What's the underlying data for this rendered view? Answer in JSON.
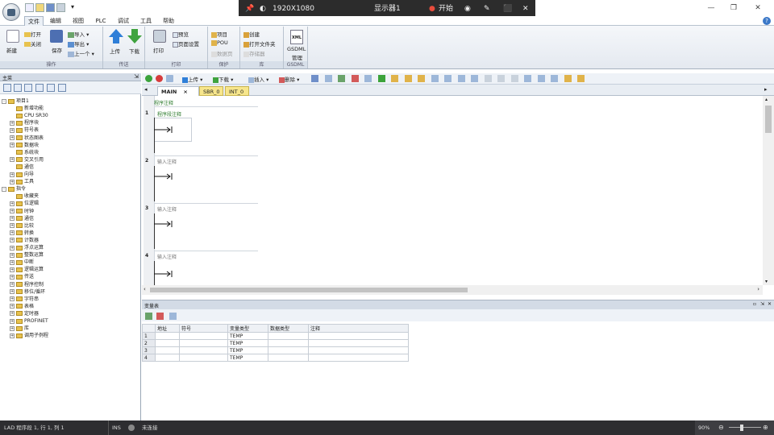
{
  "overlay": {
    "resolution": "1920X1080",
    "display": "显示器1",
    "start": "开始"
  },
  "tabs": [
    "文件",
    "编辑",
    "视图",
    "PLC",
    "调试",
    "工具",
    "帮助"
  ],
  "ribbon": {
    "new": "新建",
    "open": "打开",
    "close": "关闭",
    "save": "保存",
    "import": "导入",
    "export": "导出",
    "prev": "上一个",
    "upload": "上传",
    "download": "下载",
    "print": "打印",
    "preview": "预览",
    "page_setup": "页面设置",
    "project": "项目",
    "pou": "POU",
    "data_page": "数据页",
    "create": "创建",
    "open_folder": "打开文件夹",
    "storage": "存储器",
    "xml": "XML",
    "gsdml": "GSDML",
    "gsdml_manage": "管理",
    "groups": {
      "ops": "操作",
      "transfer": "传送",
      "print": "打印",
      "protect": "保护",
      "lib": "库",
      "gsdml": "GSDML"
    }
  },
  "left_panel": {
    "title": "主菜",
    "tree": [
      {
        "label": "项目1",
        "depth": 0,
        "exp": "-"
      },
      {
        "label": "新增功能",
        "depth": 1,
        "exp": ""
      },
      {
        "label": "CPU SR30",
        "depth": 1,
        "exp": ""
      },
      {
        "label": "程序块",
        "depth": 1,
        "exp": "+"
      },
      {
        "label": "符号表",
        "depth": 1,
        "exp": "+"
      },
      {
        "label": "状态图表",
        "depth": 1,
        "exp": "+"
      },
      {
        "label": "数据块",
        "depth": 1,
        "exp": "+"
      },
      {
        "label": "系统块",
        "depth": 1,
        "exp": ""
      },
      {
        "label": "交叉引用",
        "depth": 1,
        "exp": "+"
      },
      {
        "label": "通信",
        "depth": 1,
        "exp": ""
      },
      {
        "label": "向导",
        "depth": 1,
        "exp": "+"
      },
      {
        "label": "工具",
        "depth": 1,
        "exp": "+"
      },
      {
        "label": "指令",
        "depth": 0,
        "exp": "-"
      },
      {
        "label": "收藏夹",
        "depth": 1,
        "exp": ""
      },
      {
        "label": "位逻辑",
        "depth": 1,
        "exp": "+"
      },
      {
        "label": "时钟",
        "depth": 1,
        "exp": "+"
      },
      {
        "label": "通信",
        "depth": 1,
        "exp": "+"
      },
      {
        "label": "比较",
        "depth": 1,
        "exp": "+"
      },
      {
        "label": "转换",
        "depth": 1,
        "exp": "+"
      },
      {
        "label": "计数器",
        "depth": 1,
        "exp": "+"
      },
      {
        "label": "浮点运算",
        "depth": 1,
        "exp": "+"
      },
      {
        "label": "整数运算",
        "depth": 1,
        "exp": "+"
      },
      {
        "label": "中断",
        "depth": 1,
        "exp": "+"
      },
      {
        "label": "逻辑运算",
        "depth": 1,
        "exp": "+"
      },
      {
        "label": "传送",
        "depth": 1,
        "exp": "+"
      },
      {
        "label": "程序控制",
        "depth": 1,
        "exp": "+"
      },
      {
        "label": "移位/循环",
        "depth": 1,
        "exp": "+"
      },
      {
        "label": "字符串",
        "depth": 1,
        "exp": "+"
      },
      {
        "label": "表格",
        "depth": 1,
        "exp": "+"
      },
      {
        "label": "定时器",
        "depth": 1,
        "exp": "+"
      },
      {
        "label": "PROFINET",
        "depth": 1,
        "exp": "+"
      },
      {
        "label": "库",
        "depth": 1,
        "exp": "+"
      },
      {
        "label": "调用子例程",
        "depth": 1,
        "exp": "+"
      }
    ]
  },
  "editor": {
    "toolbar": {
      "upload": "上传",
      "download": "下载",
      "insert": "插入",
      "delete": "删除"
    },
    "tabs": [
      "MAIN",
      "SBR_0",
      "INT_0"
    ],
    "program_comment": "程序注释",
    "rungs": [
      {
        "num": "1",
        "comment": "程序段注释"
      },
      {
        "num": "2",
        "comment": "输入注释"
      },
      {
        "num": "3",
        "comment": "输入注释"
      },
      {
        "num": "4",
        "comment": "输入注释"
      }
    ]
  },
  "var_table": {
    "title": "变量表",
    "headers": [
      "",
      "地址",
      "符号",
      "变量类型",
      "数据类型",
      "注释"
    ],
    "rows": [
      [
        "1",
        "",
        "",
        "TEMP",
        "",
        ""
      ],
      [
        "2",
        "",
        "",
        "TEMP",
        "",
        ""
      ],
      [
        "3",
        "",
        "",
        "TEMP",
        "",
        ""
      ],
      [
        "4",
        "",
        "",
        "TEMP",
        "",
        ""
      ]
    ]
  },
  "status": {
    "position": "LAD 程序段 1, 行 1, 列 1",
    "mode": "INS",
    "connection": "未连接",
    "zoom": "90%"
  }
}
